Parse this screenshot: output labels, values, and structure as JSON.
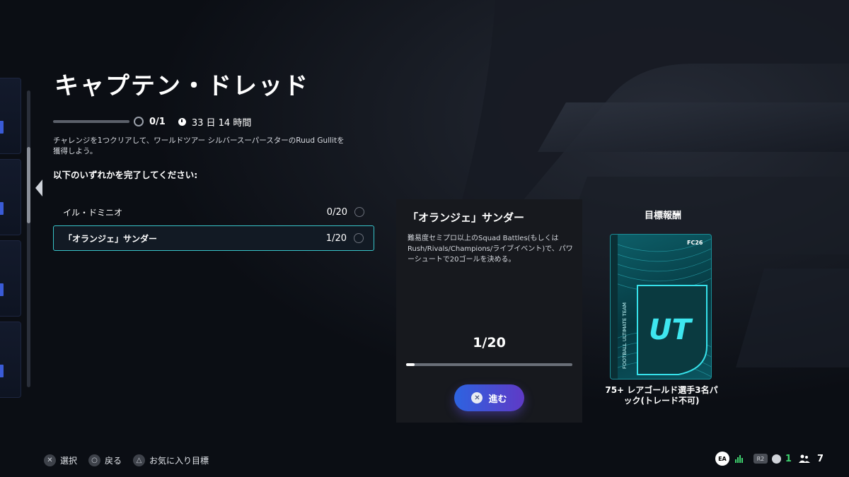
{
  "title": "キャプテン・ドレッド",
  "progress": {
    "count": "0/1",
    "fraction": 0.0,
    "time_left": "33 日 14 時間"
  },
  "description": "チャレンジを1つクリアして、ワールドツアー シルバースーパースターのRuud Gullitを獲得しよう。",
  "instruction": "以下のいずれかを完了してください:",
  "challenges": [
    {
      "name": "イル・ドミニオ",
      "count": "0/20"
    },
    {
      "name": "「オランジェ」サンダー",
      "count": "1/20"
    }
  ],
  "detail": {
    "title": "「オランジェ」サンダー",
    "text": "難易度セミプロ以上のSquad Battles(もしくはRush/Rivals/Champions/ライブイベント)で、パワーシュートで20ゴールを決める。",
    "progress": "1/20",
    "progress_fraction": 0.05,
    "button_label": "進む",
    "button_icon": "cross-button-icon"
  },
  "reward": {
    "title": "目標報酬",
    "name": "75+ レアゴールド選手3名パック(トレード不可)",
    "pack_mark": "UT",
    "pack_side_text": "FOOTBALL ULTIMATE TEAM",
    "pack_brand": "FC26"
  },
  "footer": {
    "select_label": "選択",
    "back_label": "戻る",
    "favorite_label": "お気に入り目標"
  },
  "status": {
    "ea_label": "EA",
    "r2_label": "R2",
    "party_count": "1",
    "friends_count": "7"
  },
  "colors": {
    "accent": "#38c4c9",
    "button_start": "#2d63e0",
    "button_end": "#5f3ac6",
    "online": "#3fd36f"
  }
}
